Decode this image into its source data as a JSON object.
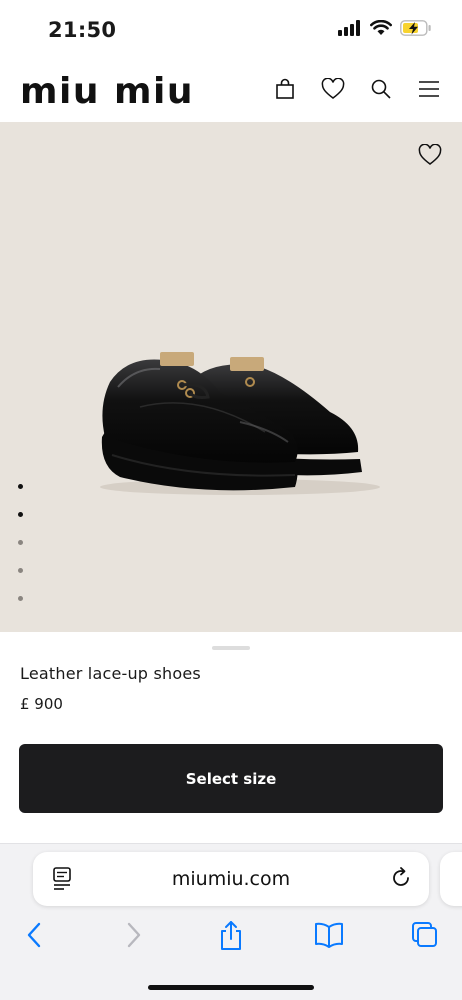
{
  "status_bar": {
    "time": "21:50"
  },
  "header": {
    "brand": "miu miu",
    "icons": [
      "bag-icon",
      "heart-icon",
      "search-icon",
      "menu-icon"
    ]
  },
  "hero": {
    "favorite_icon": "heart-icon",
    "carousel": {
      "total": 5,
      "active": [
        0,
        1
      ]
    }
  },
  "product": {
    "name": "Leather lace-up shoes",
    "price": "£ 900"
  },
  "cta": {
    "select_size": "Select size"
  },
  "browser": {
    "url": "miumiu.com",
    "toolbar": [
      "back-icon",
      "forward-icon",
      "share-icon",
      "bookmarks-icon",
      "tabs-icon"
    ]
  },
  "colors": {
    "hero_bg": "#e8e3dc",
    "button_bg": "#1c1c1e",
    "safari_blue": "#0a7aff",
    "battery_yellow": "#f7d330"
  }
}
